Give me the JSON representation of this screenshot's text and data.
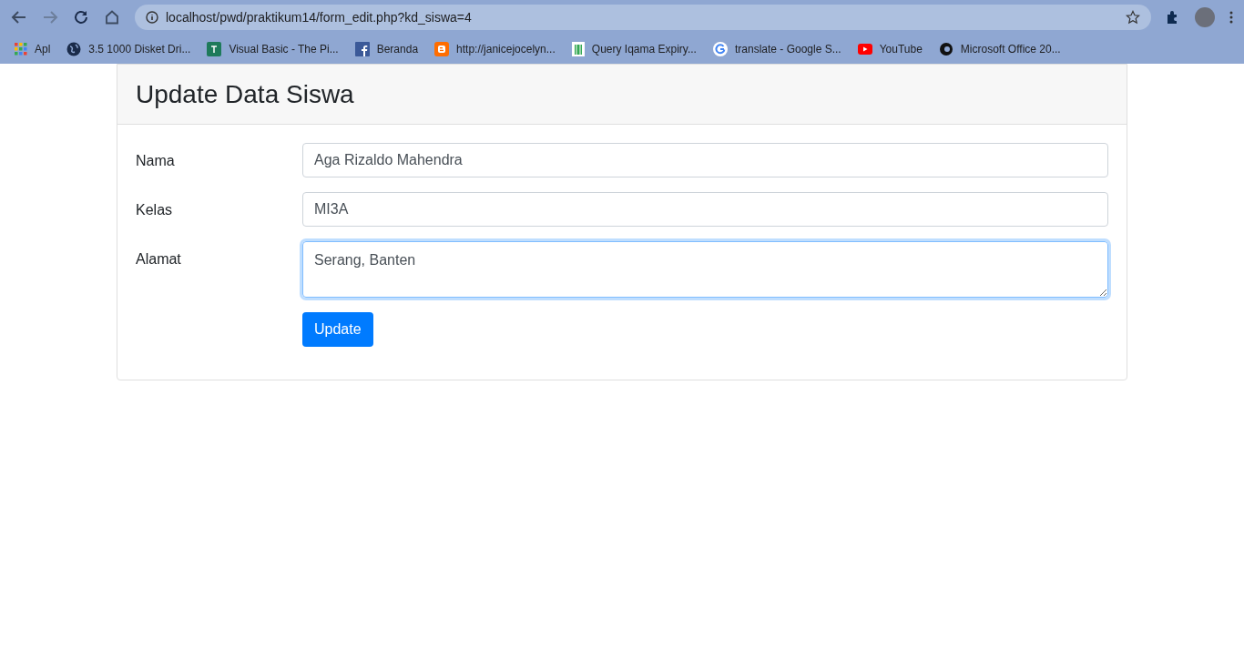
{
  "browser": {
    "url": "localhost/pwd/praktikum14/form_edit.php?kd_siswa=4",
    "bookmarks": [
      {
        "kind": "apps",
        "label": "Apl"
      },
      {
        "kind": "globe",
        "label": "3.5 1000 Disket Dri..."
      },
      {
        "kind": "tile",
        "label": "Visual Basic - The Pi..."
      },
      {
        "kind": "facebook",
        "label": "Beranda"
      },
      {
        "kind": "blogger",
        "label": "http://janicejocelyn..."
      },
      {
        "kind": "sheet",
        "label": "Query Iqama Expiry..."
      },
      {
        "kind": "google",
        "label": "translate - Google S..."
      },
      {
        "kind": "youtube",
        "label": "YouTube"
      },
      {
        "kind": "dark",
        "label": "Microsoft Office 20..."
      }
    ]
  },
  "card": {
    "title": "Update Data Siswa",
    "fields": [
      {
        "kind": "input",
        "label": "Nama",
        "value": "Aga Rizaldo Mahendra",
        "focused": false
      },
      {
        "kind": "input",
        "label": "Kelas",
        "value": "MI3A",
        "focused": false
      },
      {
        "kind": "textarea",
        "label": "Alamat",
        "value": "Serang, Banten",
        "focused": true
      }
    ],
    "button": "Update"
  }
}
